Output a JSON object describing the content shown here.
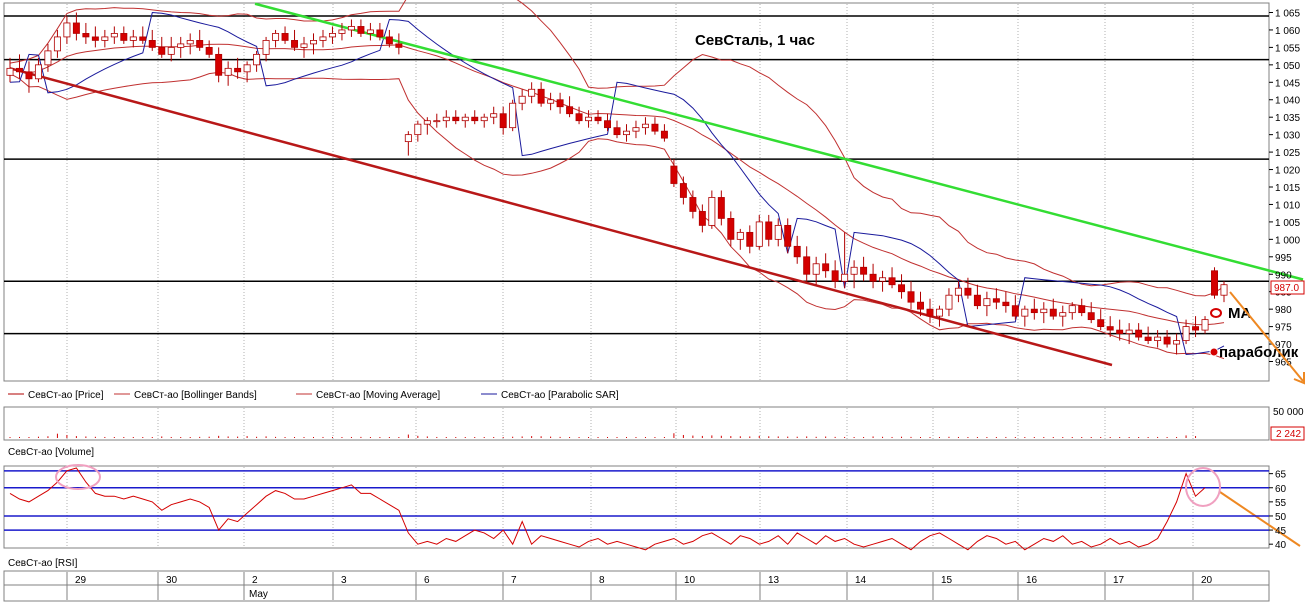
{
  "title": "СевСталь,  1 час",
  "colors": {
    "background": "#ffffff",
    "grid": "#b0b0b0",
    "candle_up": "#ffffff",
    "candle_down": "#d40000",
    "candle_outline": "#b00000",
    "bollinger": "#c03030",
    "moving_average": "#c03030",
    "parabolic_sar": "#1a1a9c",
    "resistance_line": "#33dd33",
    "support_line": "#b81818",
    "level_line": "#000000",
    "forecast_arrow": "#ee8822",
    "rsi_level": "#1a1acc",
    "highlight_circle": "#f0a0c0"
  },
  "price_panel": {
    "legend": [
      {
        "label": "СевСт-ао [Price]",
        "color": "#b00000"
      },
      {
        "label": "СевСт-ао [Bollinger Bands]",
        "color": "#c03030"
      },
      {
        "label": "СевСт-ао [Moving Average]",
        "color": "#c03030"
      },
      {
        "label": "СевСт-ао [Parabolic SAR]",
        "color": "#1a1a9c"
      }
    ],
    "y_ticks": [
      "1 065",
      "1 060",
      "1 055",
      "1 050",
      "1 045",
      "1 040",
      "1 035",
      "1 030",
      "1 025",
      "1 020",
      "1 015",
      "1 010",
      "1 005",
      "1 000",
      "995",
      "990",
      "985",
      "980",
      "975",
      "970",
      "965"
    ],
    "price_tag": "987.0",
    "annotations": {
      "ma": "MA",
      "parabolic": "параболик"
    }
  },
  "volume_panel": {
    "label": "СевСт-ао [Volume]",
    "y_tick_top": "50 000",
    "current_value": "2 242"
  },
  "rsi_panel": {
    "label": "СевСт-ао [RSI]",
    "y_ticks": [
      "65",
      "60",
      "55",
      "50",
      "45",
      "40"
    ]
  },
  "x_axis": {
    "day_labels": [
      "29",
      "30",
      "2",
      "3",
      "6",
      "7",
      "8",
      "10",
      "13",
      "14",
      "15",
      "16",
      "17",
      "20"
    ],
    "month_label": "May"
  },
  "chart_data": {
    "type": "candlestick",
    "title": "СевСталь,  1 час",
    "ylim": [
      962,
      1067
    ],
    "horizontal_levels": [
      1064,
      1051.5,
      1023,
      988,
      973
    ],
    "trend_lines": {
      "resistance": {
        "from": [
          0,
          1067.5
        ],
        "to": [
          152,
          988.5
        ]
      },
      "support": {
        "from": [
          0,
          1049
        ],
        "to": [
          128,
          964
        ]
      }
    },
    "series": [
      {
        "name": "Price",
        "ohlc": [
          [
            1047,
            1052,
            1045,
            1049
          ],
          [
            1049,
            1053,
            1046,
            1048
          ],
          [
            1048,
            1051,
            1042,
            1046
          ],
          [
            1046,
            1052,
            1045,
            1050
          ],
          [
            1050,
            1056,
            1048,
            1054
          ],
          [
            1054,
            1060,
            1052,
            1058
          ],
          [
            1058,
            1064,
            1056,
            1062
          ],
          [
            1062,
            1065,
            1057,
            1059
          ],
          [
            1059,
            1062,
            1056,
            1058
          ],
          [
            1058,
            1061,
            1055,
            1057
          ],
          [
            1057,
            1060,
            1055,
            1058
          ],
          [
            1058,
            1061,
            1056,
            1059
          ],
          [
            1059,
            1061,
            1056,
            1057
          ],
          [
            1057,
            1060,
            1055,
            1058
          ],
          [
            1058,
            1061,
            1056,
            1057
          ],
          [
            1057,
            1060,
            1054,
            1055
          ],
          [
            1055,
            1058,
            1052,
            1053
          ],
          [
            1053,
            1058,
            1051,
            1055
          ],
          [
            1055,
            1058,
            1052,
            1056
          ],
          [
            1056,
            1059,
            1053,
            1057
          ],
          [
            1057,
            1060,
            1054,
            1055
          ],
          [
            1055,
            1057,
            1052,
            1053
          ],
          [
            1053,
            1055,
            1045,
            1047
          ],
          [
            1047,
            1051,
            1044,
            1049
          ],
          [
            1049,
            1052,
            1046,
            1048
          ],
          [
            1048,
            1051,
            1045,
            1050
          ],
          [
            1050,
            1054,
            1048,
            1053
          ],
          [
            1053,
            1058,
            1051,
            1057
          ],
          [
            1057,
            1060,
            1055,
            1059
          ],
          [
            1059,
            1061,
            1056,
            1057
          ],
          [
            1057,
            1060,
            1054,
            1055
          ],
          [
            1055,
            1058,
            1052,
            1056
          ],
          [
            1056,
            1059,
            1053,
            1057
          ],
          [
            1057,
            1060,
            1055,
            1058
          ],
          [
            1058,
            1061,
            1056,
            1059
          ],
          [
            1059,
            1062,
            1057,
            1060
          ],
          [
            1060,
            1063,
            1058,
            1061
          ],
          [
            1061,
            1063,
            1058,
            1059
          ],
          [
            1059,
            1062,
            1057,
            1060
          ],
          [
            1060,
            1062,
            1057,
            1058
          ],
          [
            1058,
            1060,
            1055,
            1056
          ],
          [
            1056,
            1059,
            1053,
            1055
          ],
          [
            1028,
            1031,
            1024,
            1030
          ],
          [
            1030,
            1034,
            1028,
            1033
          ],
          [
            1033,
            1035,
            1030,
            1034
          ],
          [
            1034,
            1036,
            1032,
            1034
          ],
          [
            1034,
            1037,
            1032,
            1035
          ],
          [
            1035,
            1037,
            1033,
            1034
          ],
          [
            1034,
            1036,
            1032,
            1035
          ],
          [
            1035,
            1037,
            1033,
            1034
          ],
          [
            1034,
            1036,
            1032,
            1035
          ],
          [
            1035,
            1038,
            1033,
            1036
          ],
          [
            1036,
            1038,
            1030,
            1032
          ],
          [
            1032,
            1040,
            1031,
            1039
          ],
          [
            1039,
            1043,
            1037,
            1041
          ],
          [
            1041,
            1045,
            1039,
            1043
          ],
          [
            1043,
            1045,
            1038,
            1039
          ],
          [
            1039,
            1042,
            1037,
            1040
          ],
          [
            1040,
            1042,
            1036,
            1038
          ],
          [
            1038,
            1041,
            1035,
            1036
          ],
          [
            1036,
            1038,
            1033,
            1034
          ],
          [
            1034,
            1037,
            1032,
            1035
          ],
          [
            1035,
            1037,
            1033,
            1034
          ],
          [
            1034,
            1036,
            1031,
            1032
          ],
          [
            1032,
            1034,
            1029,
            1030
          ],
          [
            1030,
            1033,
            1028,
            1031
          ],
          [
            1031,
            1034,
            1029,
            1032
          ],
          [
            1032,
            1035,
            1030,
            1033
          ],
          [
            1033,
            1035,
            1030,
            1031
          ],
          [
            1031,
            1033,
            1028,
            1029
          ],
          [
            1021,
            1023,
            1015,
            1016
          ],
          [
            1016,
            1018,
            1010,
            1012
          ],
          [
            1012,
            1014,
            1006,
            1008
          ],
          [
            1008,
            1010,
            1002,
            1004
          ],
          [
            1004,
            1014,
            1003,
            1012
          ],
          [
            1012,
            1014,
            1004,
            1006
          ],
          [
            1006,
            1008,
            998,
            1000
          ],
          [
            1000,
            1003,
            997,
            1002
          ],
          [
            1002,
            1004,
            996,
            998
          ],
          [
            998,
            1007,
            997,
            1005
          ],
          [
            1005,
            1007,
            998,
            1000
          ],
          [
            1000,
            1006,
            998,
            1004
          ],
          [
            1004,
            1006,
            996,
            998
          ],
          [
            998,
            1001,
            993,
            995
          ],
          [
            995,
            998,
            988,
            990
          ],
          [
            990,
            995,
            987,
            993
          ],
          [
            993,
            996,
            989,
            991
          ],
          [
            991,
            994,
            986,
            988
          ],
          [
            988,
            1002,
            986,
            990
          ],
          [
            990,
            994,
            986,
            992
          ],
          [
            992,
            995,
            988,
            990
          ],
          [
            990,
            993,
            986,
            988
          ],
          [
            988,
            991,
            985,
            989
          ],
          [
            989,
            992,
            986,
            987
          ],
          [
            987,
            990,
            983,
            985
          ],
          [
            985,
            988,
            980,
            982
          ],
          [
            982,
            985,
            978,
            980
          ],
          [
            980,
            983,
            976,
            978
          ],
          [
            978,
            981,
            975,
            980
          ],
          [
            980,
            986,
            978,
            984
          ],
          [
            984,
            988,
            982,
            986
          ],
          [
            986,
            989,
            983,
            984
          ],
          [
            984,
            987,
            980,
            981
          ],
          [
            981,
            985,
            978,
            983
          ],
          [
            983,
            986,
            980,
            982
          ],
          [
            982,
            985,
            979,
            981
          ],
          [
            981,
            984,
            977,
            978
          ],
          [
            978,
            981,
            975,
            980
          ],
          [
            980,
            983,
            977,
            979
          ],
          [
            979,
            982,
            976,
            980
          ],
          [
            980,
            983,
            977,
            978
          ],
          [
            978,
            981,
            975,
            979
          ],
          [
            979,
            982,
            977,
            981
          ],
          [
            981,
            983,
            978,
            979
          ],
          [
            979,
            982,
            976,
            977
          ],
          [
            977,
            980,
            974,
            975
          ],
          [
            975,
            978,
            972,
            974
          ],
          [
            974,
            977,
            971,
            973
          ],
          [
            973,
            976,
            970,
            974
          ],
          [
            974,
            976,
            971,
            972
          ],
          [
            972,
            975,
            970,
            971
          ],
          [
            971,
            974,
            969,
            972
          ],
          [
            972,
            974,
            969,
            970
          ],
          [
            970,
            973,
            967,
            971
          ],
          [
            971,
            977,
            970,
            975
          ],
          [
            975,
            978,
            972,
            974
          ],
          [
            974,
            978,
            973,
            977
          ],
          [
            991,
            992,
            983,
            984
          ],
          [
            984,
            988,
            982,
            987
          ]
        ]
      },
      {
        "name": "Moving Average"
      },
      {
        "name": "Bollinger Bands"
      },
      {
        "name": "Parabolic SAR"
      }
    ],
    "rsi_levels": [
      66,
      60,
      50,
      45
    ],
    "rsi_values": [
      58,
      56,
      55,
      57,
      59,
      62,
      66,
      67,
      62,
      58,
      57,
      57,
      56,
      57,
      56,
      55,
      52,
      54,
      55,
      56,
      55,
      53,
      45,
      49,
      48,
      51,
      54,
      57,
      59,
      58,
      56,
      56,
      57,
      58,
      59,
      60,
      61,
      58,
      58,
      56,
      54,
      52,
      44,
      40,
      41,
      40,
      42,
      41,
      43,
      45,
      44,
      42,
      45,
      40,
      48,
      40,
      43,
      42,
      41,
      40,
      39,
      41,
      42,
      40,
      41,
      40,
      39,
      38,
      40,
      41,
      42,
      40,
      41,
      43,
      44,
      42,
      40,
      43,
      42,
      40,
      41,
      43,
      40,
      44,
      42,
      40,
      43,
      41,
      42,
      40,
      39,
      40,
      41,
      42,
      40,
      38,
      41,
      43,
      44,
      42,
      40,
      38,
      41,
      43,
      42,
      40,
      41,
      38,
      40,
      42,
      41,
      43,
      40,
      41,
      39,
      40,
      42,
      40,
      41,
      39,
      40,
      42,
      48,
      55,
      65,
      57,
      60
    ],
    "volume_values": [
      800,
      1200,
      900,
      1500,
      2000,
      5000,
      3500,
      2200,
      1800,
      1400,
      1200,
      900,
      800,
      1100,
      900,
      700,
      1800,
      1200,
      900,
      1000,
      1300,
      1500,
      2500,
      1800,
      1600,
      2200,
      1400,
      1900,
      1300,
      1100,
      1000,
      900,
      1100,
      1200,
      900,
      1000,
      1200,
      1300,
      1100,
      900,
      800,
      700,
      4000,
      2500,
      1800,
      1200,
      1000,
      900,
      800,
      700,
      900,
      800,
      1000,
      1500,
      1800,
      2200,
      2000,
      1600,
      1300,
      1100,
      900,
      1000,
      800,
      900,
      1100,
      1000,
      900,
      800,
      700,
      1000,
      5500,
      3500,
      2800,
      2400,
      3000,
      2600,
      2200,
      2000,
      1800,
      2400,
      2000,
      1800,
      1600,
      1500,
      1800,
      1400,
      1700,
      1300,
      1200,
      1100,
      1000,
      1800,
      1400,
      1200,
      1500,
      1300,
      1100,
      1000,
      900,
      1400,
      1200,
      1100,
      1000,
      900,
      800,
      1200,
      1000,
      900,
      800,
      700,
      1100,
      900,
      800,
      700,
      600,
      900,
      800,
      700,
      800,
      900,
      1000,
      1200,
      1100,
      1000,
      3000,
      2242
    ],
    "x_day_labels": [
      "29",
      "30",
      "2",
      "3",
      "6",
      "7",
      "8",
      "10",
      "13",
      "14",
      "15",
      "16",
      "17",
      "20"
    ],
    "x_month_label": "May"
  }
}
